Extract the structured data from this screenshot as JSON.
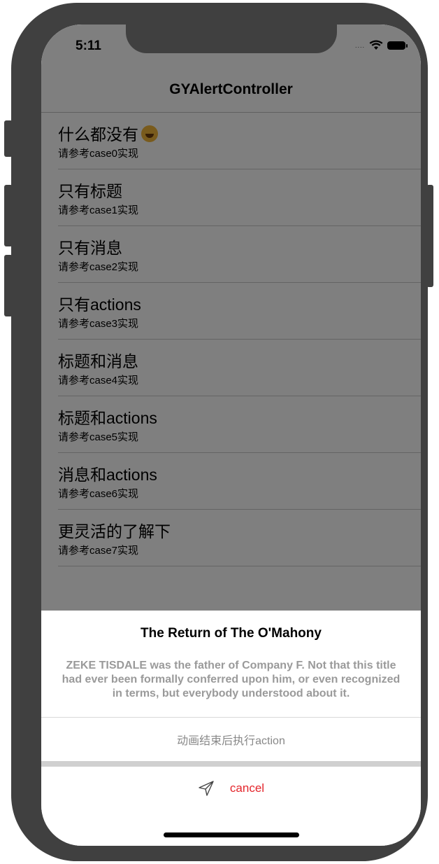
{
  "status_bar": {
    "time": "5:11",
    "signal": "....",
    "wifi_icon": "wifi-icon",
    "battery_icon": "battery-icon"
  },
  "nav": {
    "title": "GYAlertController"
  },
  "list": [
    {
      "title": "什么都没有",
      "subtitle": "请参考case0实现",
      "emoji": "grinning-squinting-face"
    },
    {
      "title": "只有标题",
      "subtitle": "请参考case1实现"
    },
    {
      "title": "只有消息",
      "subtitle": "请参考case2实现"
    },
    {
      "title": "只有actions",
      "subtitle": "请参考case3实现"
    },
    {
      "title": "标题和消息",
      "subtitle": "请参考case4实现"
    },
    {
      "title": "标题和actions",
      "subtitle": "请参考case5实现"
    },
    {
      "title": "消息和actions",
      "subtitle": "请参考case6实现"
    },
    {
      "title": "更灵活的了解下",
      "subtitle": "请参考case7实现"
    }
  ],
  "sheet": {
    "title": "The Return of The O'Mahony",
    "message": "ZEKE TISDALE was the father of Company F. Not that this title had ever been formally conferred upon him, or even recognized in terms, but everybody understood about it.",
    "action_label": "动画结束后执行action",
    "cancel_label": "cancel",
    "cancel_icon": "send-icon"
  },
  "colors": {
    "overlay": "#7f7f7f",
    "cancel": "#e4262c",
    "action": "#888888",
    "message": "#9a9a9a"
  }
}
